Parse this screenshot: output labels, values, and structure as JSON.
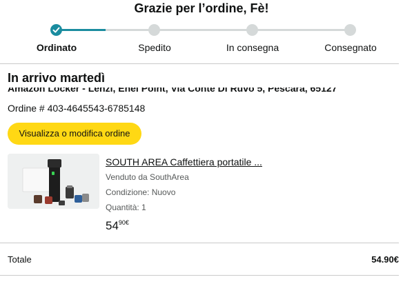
{
  "header": {
    "title": "Grazie per l’ordine, Fè!"
  },
  "progress": {
    "steps": [
      {
        "label": "Ordinato",
        "done": true
      },
      {
        "label": "Spedito",
        "done": false
      },
      {
        "label": "In consegna",
        "done": false
      },
      {
        "label": "Consegnato",
        "done": false
      }
    ],
    "accent_color": "#1a8c9f",
    "inactive_color": "#d5d9d9"
  },
  "delivery": {
    "arrival": "In arrivo martedì",
    "address": "Amazon Locker - Lenzi, Enel Point, Via Conte Di Ruvo 5, Pescara, 65127",
    "order_number": "Ordine # 403-4645543-6785148",
    "manage_button": "Visualizza o modifica ordine"
  },
  "product": {
    "title": "SOUTH AREA Caffettiera portatile ...",
    "seller": "Venduto da SouthArea",
    "condition": "Condizione: Nuovo",
    "quantity": "Quantità: 1",
    "price_whole": "54",
    "price_fraction": "90€",
    "image_icon": "portable-espresso-maker-image"
  },
  "summary": {
    "total_label": "Totale",
    "total_value": "54.90€"
  },
  "colors": {
    "button": "#ffd814",
    "accent": "#1a8c9f"
  }
}
